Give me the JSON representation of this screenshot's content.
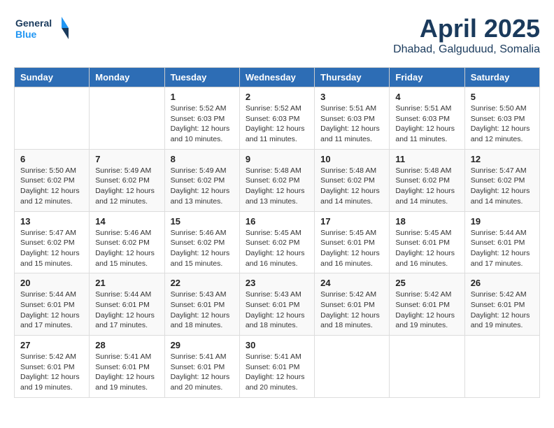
{
  "header": {
    "logo_line1": "General",
    "logo_line2": "Blue",
    "month_year": "April 2025",
    "location": "Dhabad, Galguduud, Somalia"
  },
  "days_of_week": [
    "Sunday",
    "Monday",
    "Tuesday",
    "Wednesday",
    "Thursday",
    "Friday",
    "Saturday"
  ],
  "weeks": [
    [
      {
        "day": "",
        "info": ""
      },
      {
        "day": "",
        "info": ""
      },
      {
        "day": "1",
        "info": "Sunrise: 5:52 AM\nSunset: 6:03 PM\nDaylight: 12 hours\nand 10 minutes."
      },
      {
        "day": "2",
        "info": "Sunrise: 5:52 AM\nSunset: 6:03 PM\nDaylight: 12 hours\nand 11 minutes."
      },
      {
        "day": "3",
        "info": "Sunrise: 5:51 AM\nSunset: 6:03 PM\nDaylight: 12 hours\nand 11 minutes."
      },
      {
        "day": "4",
        "info": "Sunrise: 5:51 AM\nSunset: 6:03 PM\nDaylight: 12 hours\nand 11 minutes."
      },
      {
        "day": "5",
        "info": "Sunrise: 5:50 AM\nSunset: 6:03 PM\nDaylight: 12 hours\nand 12 minutes."
      }
    ],
    [
      {
        "day": "6",
        "info": "Sunrise: 5:50 AM\nSunset: 6:02 PM\nDaylight: 12 hours\nand 12 minutes."
      },
      {
        "day": "7",
        "info": "Sunrise: 5:49 AM\nSunset: 6:02 PM\nDaylight: 12 hours\nand 12 minutes."
      },
      {
        "day": "8",
        "info": "Sunrise: 5:49 AM\nSunset: 6:02 PM\nDaylight: 12 hours\nand 13 minutes."
      },
      {
        "day": "9",
        "info": "Sunrise: 5:48 AM\nSunset: 6:02 PM\nDaylight: 12 hours\nand 13 minutes."
      },
      {
        "day": "10",
        "info": "Sunrise: 5:48 AM\nSunset: 6:02 PM\nDaylight: 12 hours\nand 14 minutes."
      },
      {
        "day": "11",
        "info": "Sunrise: 5:48 AM\nSunset: 6:02 PM\nDaylight: 12 hours\nand 14 minutes."
      },
      {
        "day": "12",
        "info": "Sunrise: 5:47 AM\nSunset: 6:02 PM\nDaylight: 12 hours\nand 14 minutes."
      }
    ],
    [
      {
        "day": "13",
        "info": "Sunrise: 5:47 AM\nSunset: 6:02 PM\nDaylight: 12 hours\nand 15 minutes."
      },
      {
        "day": "14",
        "info": "Sunrise: 5:46 AM\nSunset: 6:02 PM\nDaylight: 12 hours\nand 15 minutes."
      },
      {
        "day": "15",
        "info": "Sunrise: 5:46 AM\nSunset: 6:02 PM\nDaylight: 12 hours\nand 15 minutes."
      },
      {
        "day": "16",
        "info": "Sunrise: 5:45 AM\nSunset: 6:02 PM\nDaylight: 12 hours\nand 16 minutes."
      },
      {
        "day": "17",
        "info": "Sunrise: 5:45 AM\nSunset: 6:01 PM\nDaylight: 12 hours\nand 16 minutes."
      },
      {
        "day": "18",
        "info": "Sunrise: 5:45 AM\nSunset: 6:01 PM\nDaylight: 12 hours\nand 16 minutes."
      },
      {
        "day": "19",
        "info": "Sunrise: 5:44 AM\nSunset: 6:01 PM\nDaylight: 12 hours\nand 17 minutes."
      }
    ],
    [
      {
        "day": "20",
        "info": "Sunrise: 5:44 AM\nSunset: 6:01 PM\nDaylight: 12 hours\nand 17 minutes."
      },
      {
        "day": "21",
        "info": "Sunrise: 5:44 AM\nSunset: 6:01 PM\nDaylight: 12 hours\nand 17 minutes."
      },
      {
        "day": "22",
        "info": "Sunrise: 5:43 AM\nSunset: 6:01 PM\nDaylight: 12 hours\nand 18 minutes."
      },
      {
        "day": "23",
        "info": "Sunrise: 5:43 AM\nSunset: 6:01 PM\nDaylight: 12 hours\nand 18 minutes."
      },
      {
        "day": "24",
        "info": "Sunrise: 5:42 AM\nSunset: 6:01 PM\nDaylight: 12 hours\nand 18 minutes."
      },
      {
        "day": "25",
        "info": "Sunrise: 5:42 AM\nSunset: 6:01 PM\nDaylight: 12 hours\nand 19 minutes."
      },
      {
        "day": "26",
        "info": "Sunrise: 5:42 AM\nSunset: 6:01 PM\nDaylight: 12 hours\nand 19 minutes."
      }
    ],
    [
      {
        "day": "27",
        "info": "Sunrise: 5:42 AM\nSunset: 6:01 PM\nDaylight: 12 hours\nand 19 minutes."
      },
      {
        "day": "28",
        "info": "Sunrise: 5:41 AM\nSunset: 6:01 PM\nDaylight: 12 hours\nand 19 minutes."
      },
      {
        "day": "29",
        "info": "Sunrise: 5:41 AM\nSunset: 6:01 PM\nDaylight: 12 hours\nand 20 minutes."
      },
      {
        "day": "30",
        "info": "Sunrise: 5:41 AM\nSunset: 6:01 PM\nDaylight: 12 hours\nand 20 minutes."
      },
      {
        "day": "",
        "info": ""
      },
      {
        "day": "",
        "info": ""
      },
      {
        "day": "",
        "info": ""
      }
    ]
  ]
}
